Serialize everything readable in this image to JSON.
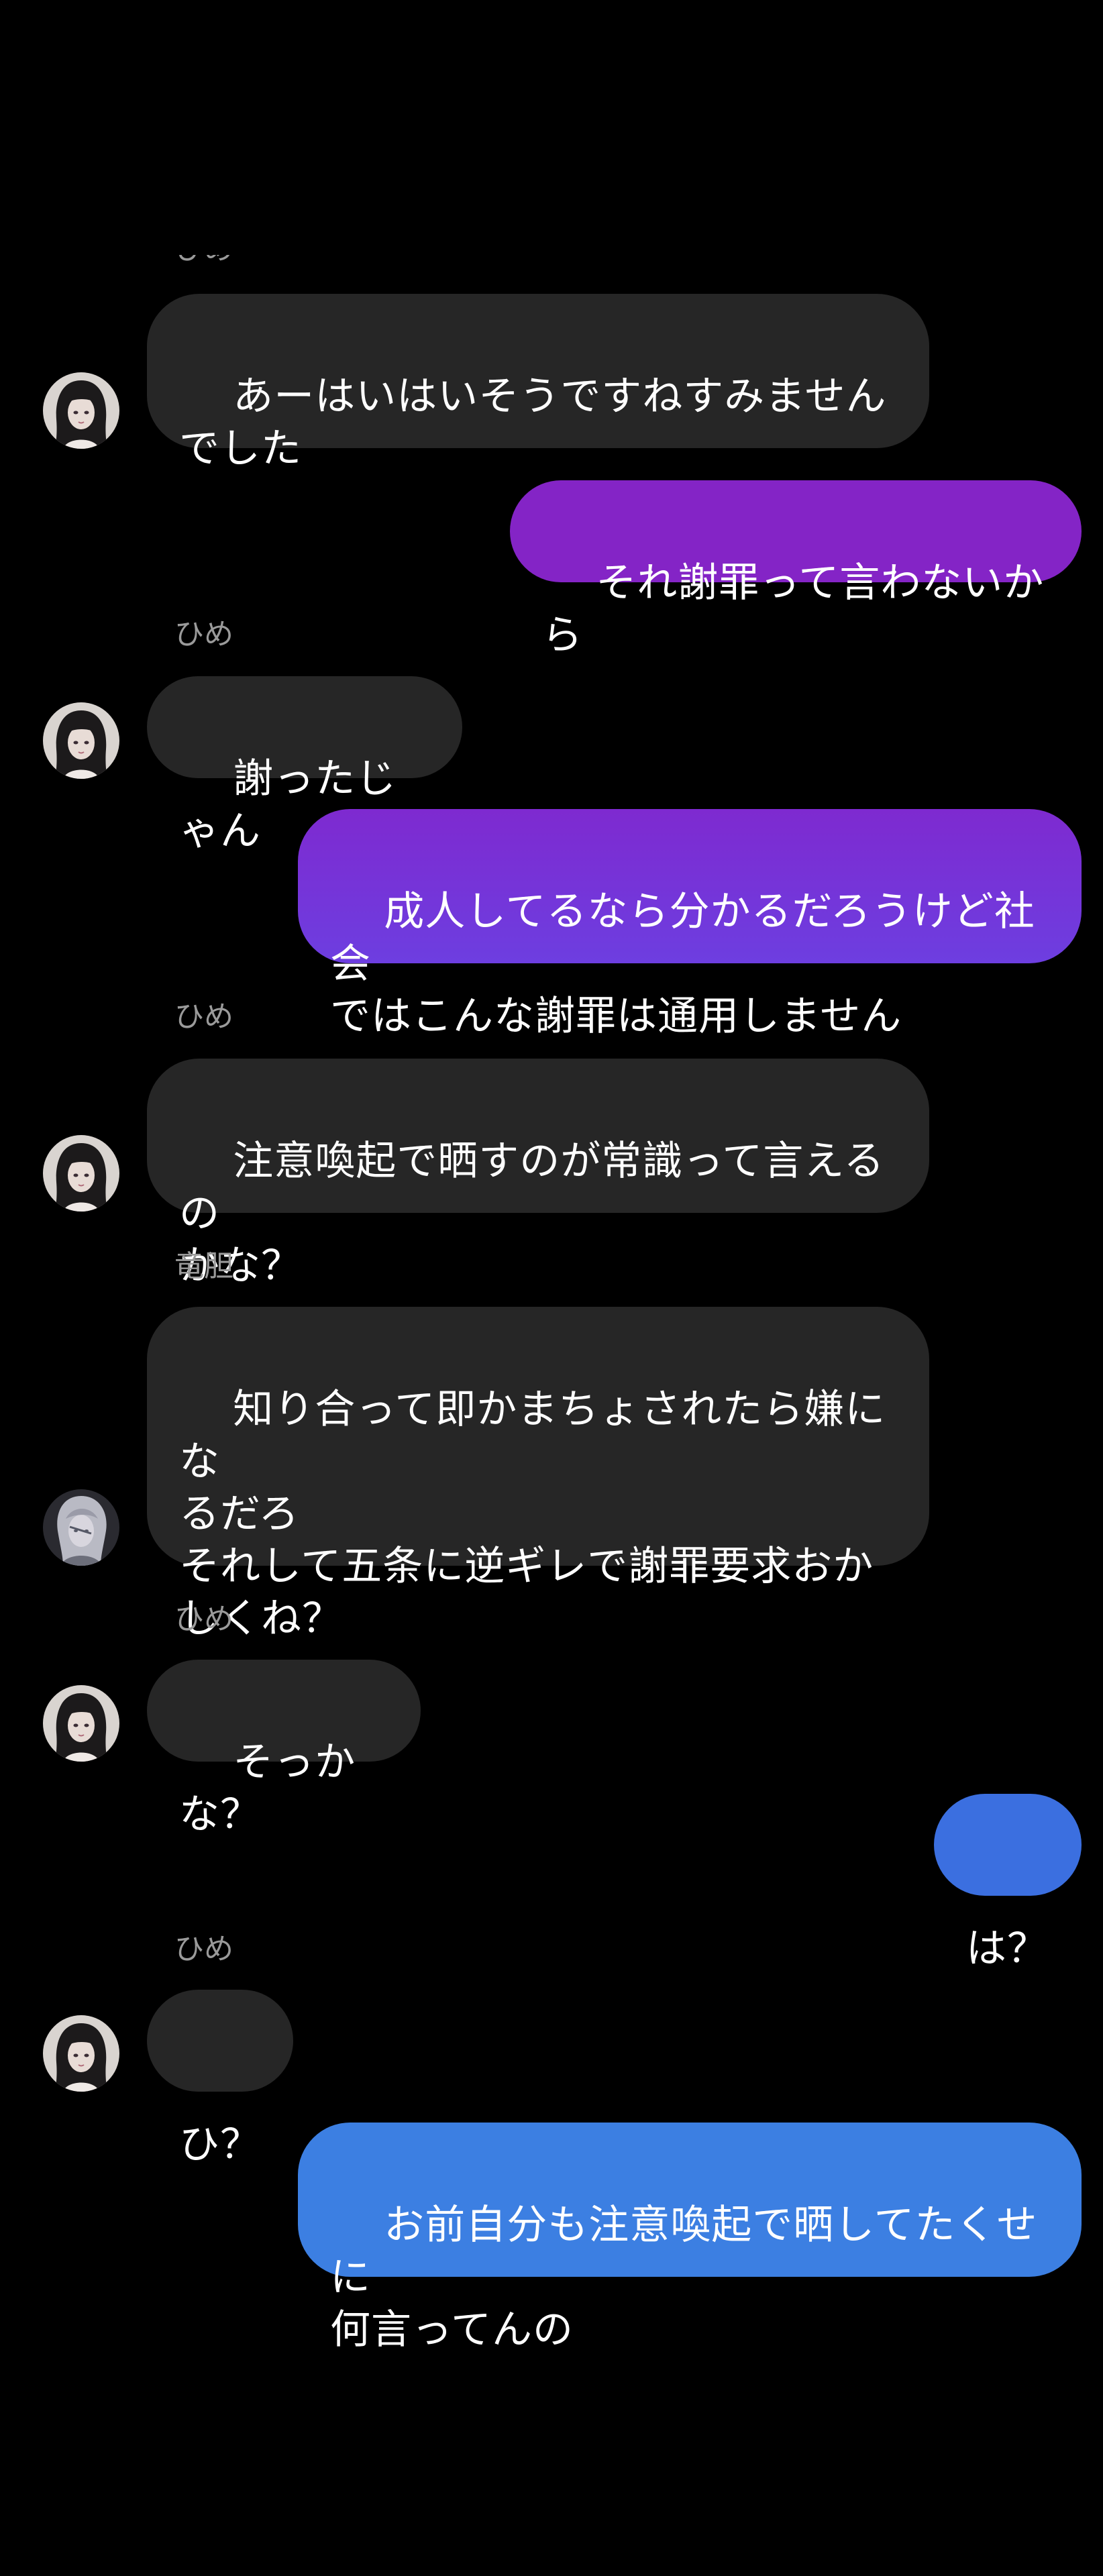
{
  "colors": {
    "background": "#000000",
    "incoming_bubble": "#262626",
    "sender_name": "#9a9a9a",
    "outgoing_purple_top": "#8a22c9",
    "outgoing_purple_bottom": "#6d3fe0",
    "outgoing_blue": "#3b7de3"
  },
  "messages": [
    {
      "sender": "ひめ",
      "direction": "incoming",
      "text": "あーはいはいそうですねすみません\nでした",
      "avatar": "hime-avatar-icon"
    },
    {
      "direction": "outgoing",
      "text": "それ謝罪って言わないから"
    },
    {
      "sender": "ひめ",
      "direction": "incoming",
      "text": "謝ったじゃん",
      "avatar": "hime-avatar-icon"
    },
    {
      "direction": "outgoing",
      "text": "成人してるなら分かるだろうけど社会\nではこんな謝罪は通用しません"
    },
    {
      "sender": "ひめ",
      "direction": "incoming",
      "text": "注意喚起で晒すのが常識って言えるの\nかな？",
      "avatar": "hime-avatar-icon"
    },
    {
      "sender": "竜胆",
      "direction": "incoming",
      "text": "知り合って即かまちょされたら嫌にな\nるだろ\nそれして五条に逆ギレで謝罪要求おか\nしくね？",
      "avatar": "rindou-avatar-icon"
    },
    {
      "sender": "ひめ",
      "direction": "incoming",
      "text": "そっかな？",
      "avatar": "hime-avatar-icon"
    },
    {
      "direction": "outgoing",
      "text": "は？"
    },
    {
      "sender": "ひめ",
      "direction": "incoming",
      "text": "ひ？",
      "avatar": "hime-avatar-icon"
    },
    {
      "direction": "outgoing",
      "text": "お前自分も注意喚起で晒してたくせに\n何言ってんの"
    }
  ]
}
